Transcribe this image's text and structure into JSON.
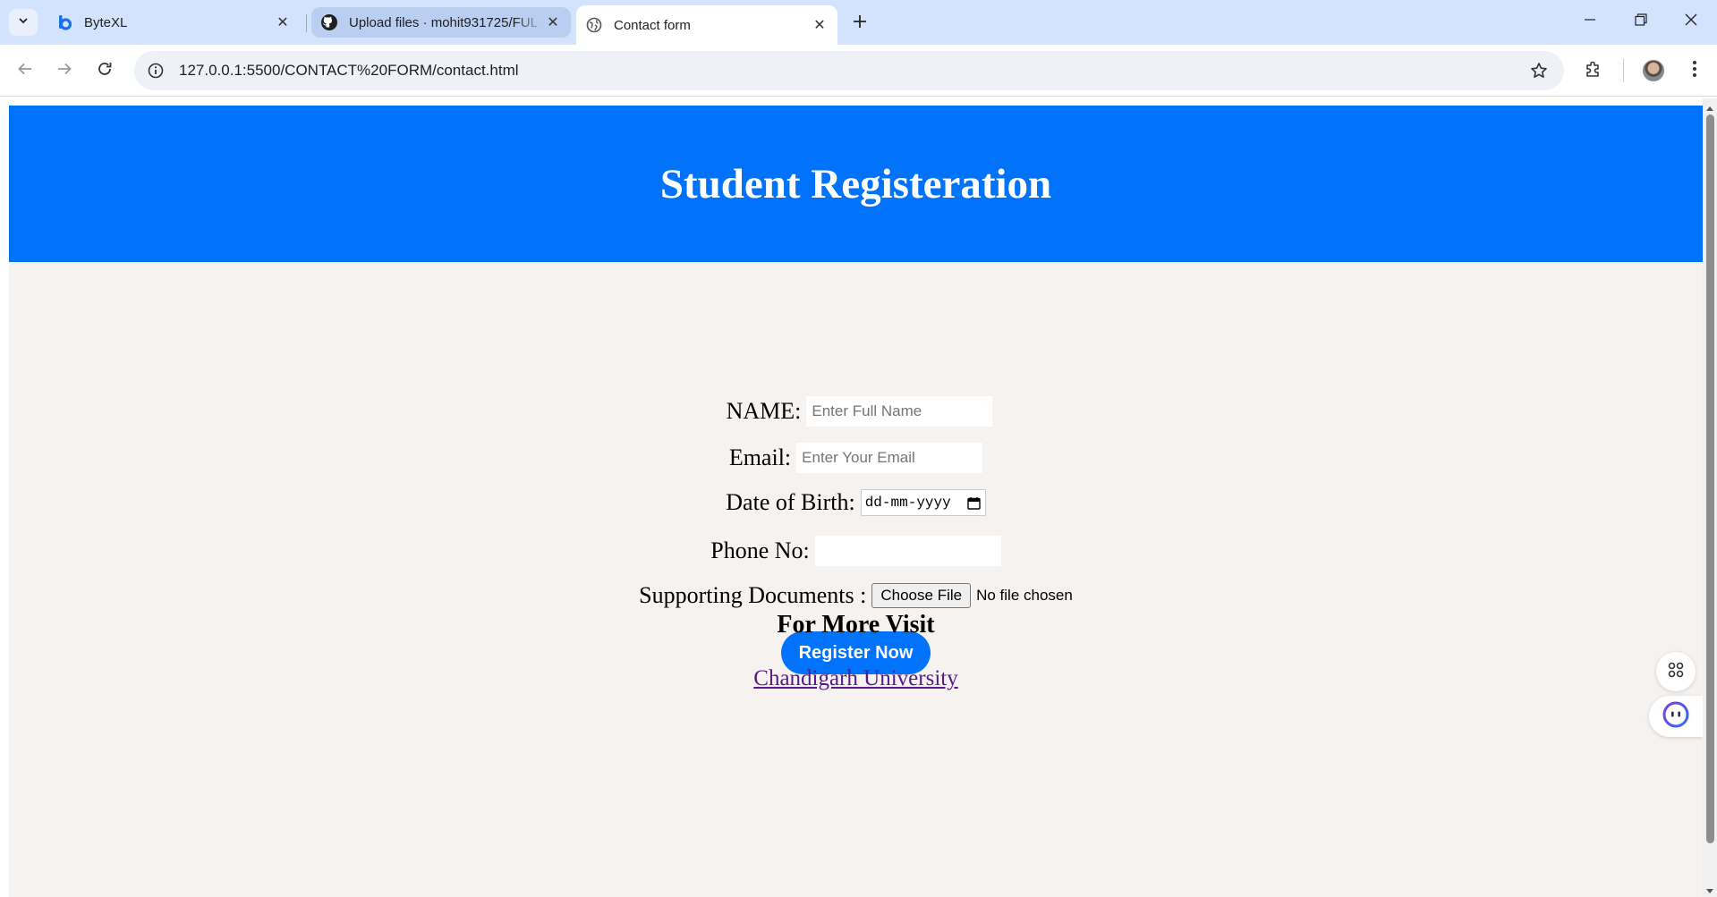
{
  "browser": {
    "tabs": [
      {
        "title": "ByteXL",
        "favicon": "bytexl-b-logo",
        "active": false
      },
      {
        "title": "Upload files · mohit931725/FUL",
        "favicon": "github-icon",
        "active": false
      },
      {
        "title": "Contact form",
        "favicon": "globe-icon",
        "active": true
      }
    ],
    "address": "127.0.0.1:5500/CONTACT%20FORM/contact.html",
    "colors": {
      "tabstrip": "#d3e3fd",
      "omnibox": "#eef1f8"
    }
  },
  "page": {
    "header_title": "Student Registeration",
    "colors": {
      "accent": "#0073fa",
      "background": "#f5f2f0",
      "link_visited": "#551a8b"
    },
    "form": {
      "name_label": "NAME:",
      "name_placeholder": "Enter Full Name",
      "email_label": "Email:",
      "email_placeholder": "Enter Your Email",
      "dob_label": "Date of Birth:",
      "dob_placeholder": "dd-mm-yyyy",
      "phone_label": "Phone No:",
      "docs_label": "Supporting Documents :",
      "choose_file_label": "Choose File",
      "no_file_text": "No file chosen",
      "submit_label": "Register Now"
    },
    "more_title": "For More Visit",
    "link_text": "Chandigarh University"
  }
}
